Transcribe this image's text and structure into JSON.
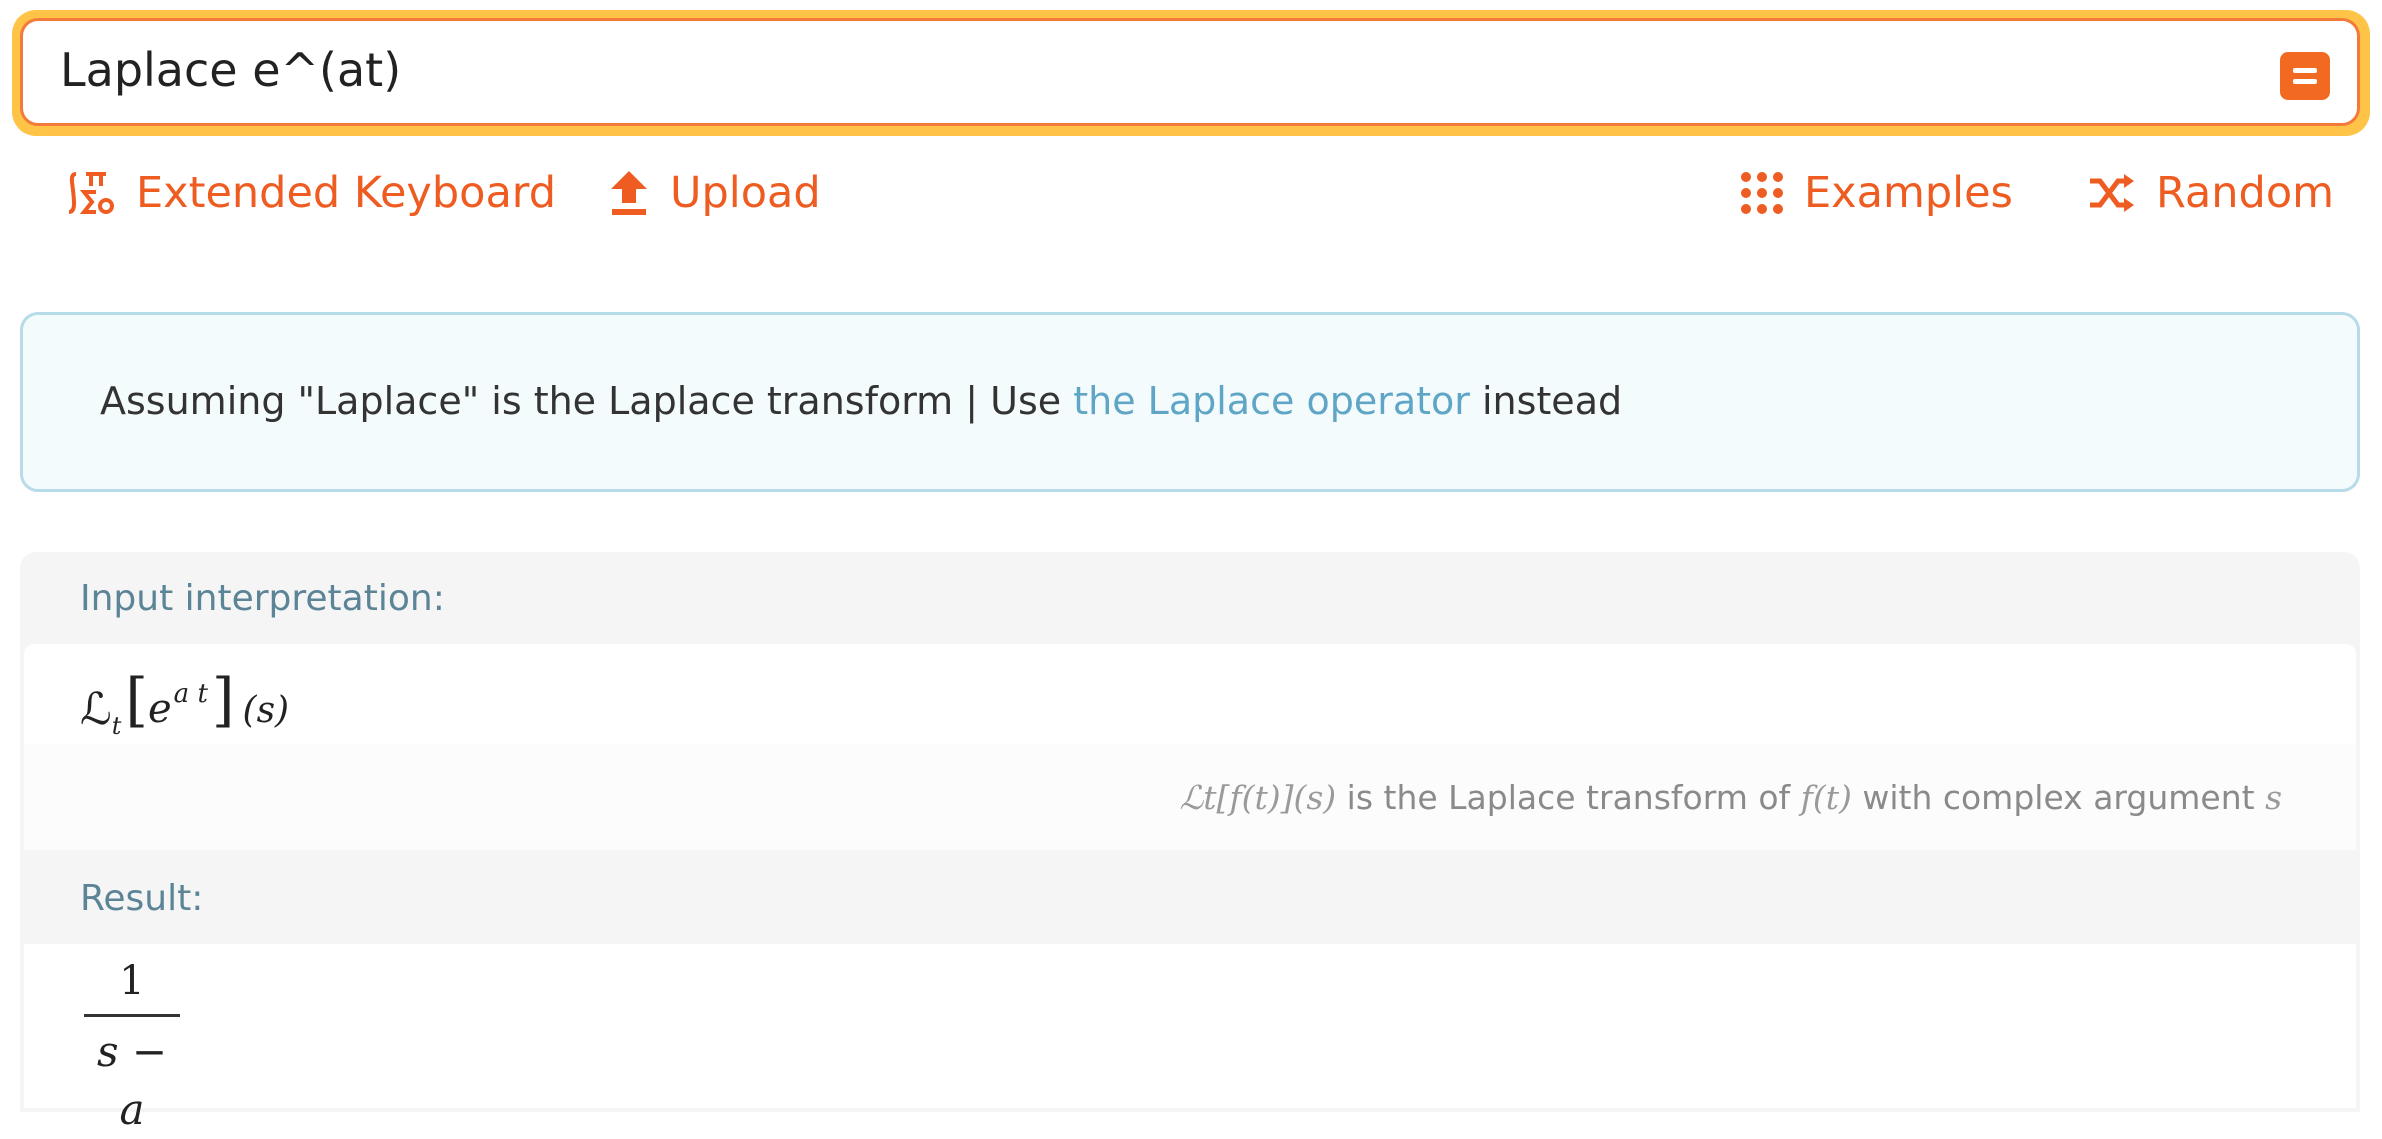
{
  "search": {
    "query": "Laplace e^(at)",
    "compute_label": "="
  },
  "toolbar": {
    "extended_keyboard": "Extended Keyboard",
    "upload": "Upload",
    "examples": "Examples",
    "random": "Random"
  },
  "assumption": {
    "prefix": "Assuming \"Laplace\" is the Laplace transform | Use ",
    "link": "the Laplace operator",
    "suffix": " instead"
  },
  "pods": {
    "input_title": "Input interpretation:",
    "input_expr": {
      "operator": "ℒ",
      "subscript": "t",
      "base": "e",
      "exponent": "a t",
      "argument": "(s)"
    },
    "note": {
      "expr": "ℒt[f(t)](s)",
      "text_1": " is the Laplace transform of ",
      "func": "f(t)",
      "text_2": " with complex argument ",
      "arg": "s"
    },
    "result_title": "Result:",
    "result": {
      "numerator": "1",
      "denominator": "s − a"
    }
  },
  "colors": {
    "accent_orange": "#ee5c21",
    "focus_ring": "#ffc447",
    "link_blue": "#5fa6c6",
    "pod_title": "#5b8597"
  },
  "icons": [
    "extended-keyboard-icon",
    "upload-icon",
    "examples-grid-icon",
    "random-shuffle-icon",
    "equals-icon"
  ]
}
